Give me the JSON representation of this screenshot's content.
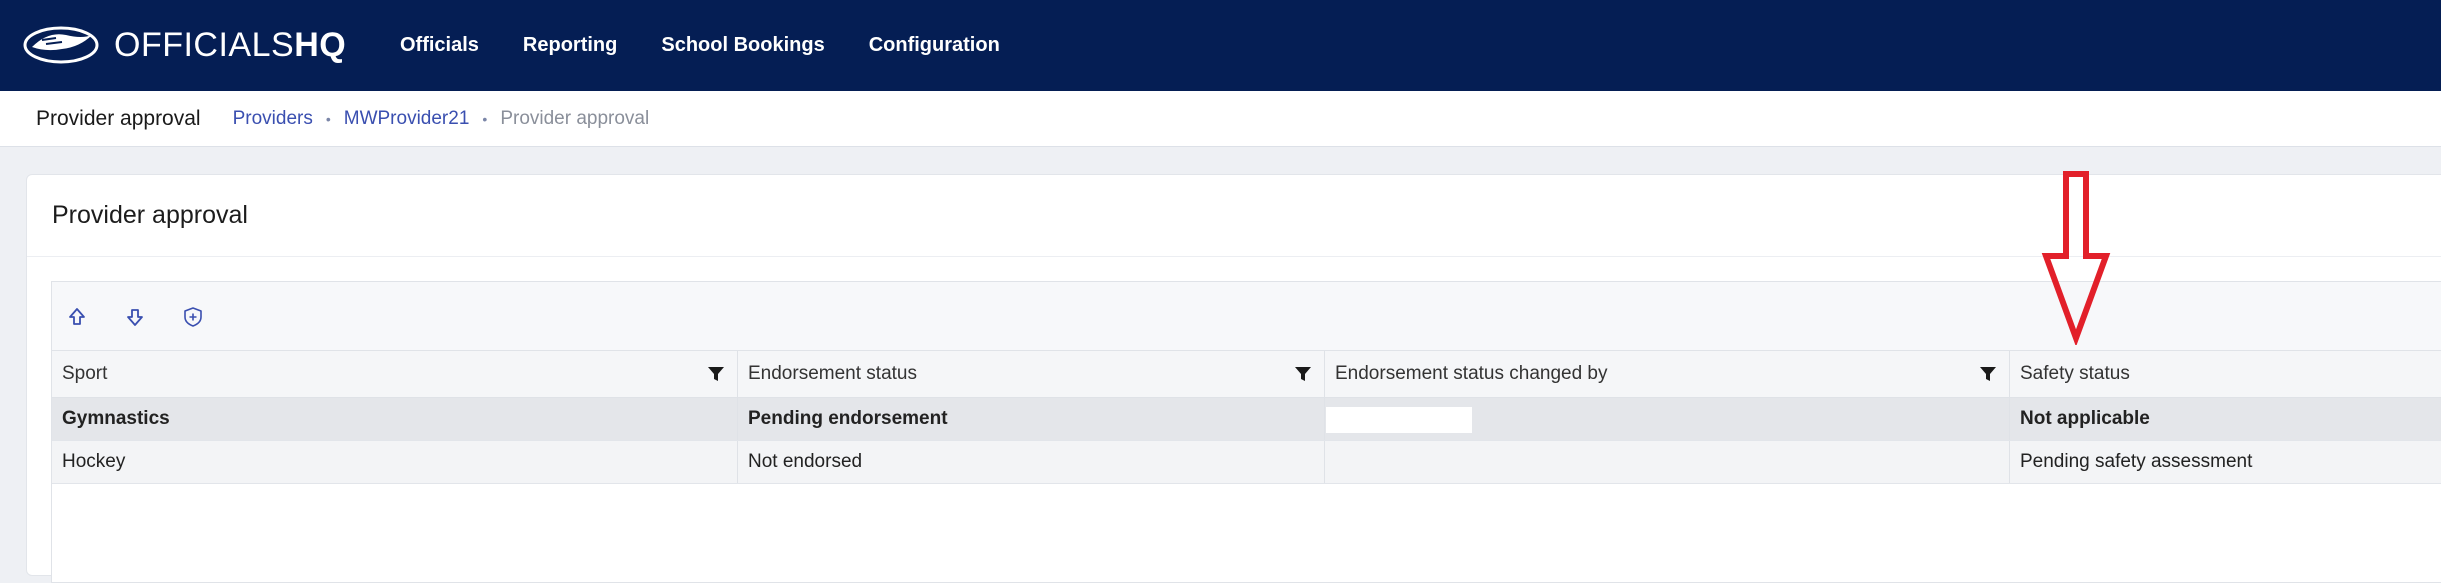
{
  "topbar": {
    "logo_light": "OFFICIALS",
    "logo_bold": "HQ",
    "nav": [
      "Officials",
      "Reporting",
      "School Bookings",
      "Configuration"
    ]
  },
  "breadcrumb": {
    "page_title": "Provider approval",
    "links": [
      "Providers",
      "MWProvider21"
    ],
    "current": "Provider approval",
    "separator": "•"
  },
  "card": {
    "title": "Provider approval"
  },
  "toolbar": {
    "buttons": [
      "move-up-icon",
      "move-down-icon",
      "shield-add-icon"
    ]
  },
  "table": {
    "columns": [
      "Sport",
      "Endorsement status",
      "Endorsement status changed by",
      "Safety status"
    ],
    "rows": [
      {
        "sport": "Gymnastics",
        "endorsement": "Pending endorsement",
        "changed_by": "",
        "safety": "Not applicable"
      },
      {
        "sport": "Hockey",
        "endorsement": "Not endorsed",
        "changed_by": "",
        "safety": "Pending safety assessment"
      }
    ]
  },
  "colors": {
    "nav_bg": "#051e54",
    "link": "#3a4fb0",
    "annotation": "#e2202a"
  }
}
